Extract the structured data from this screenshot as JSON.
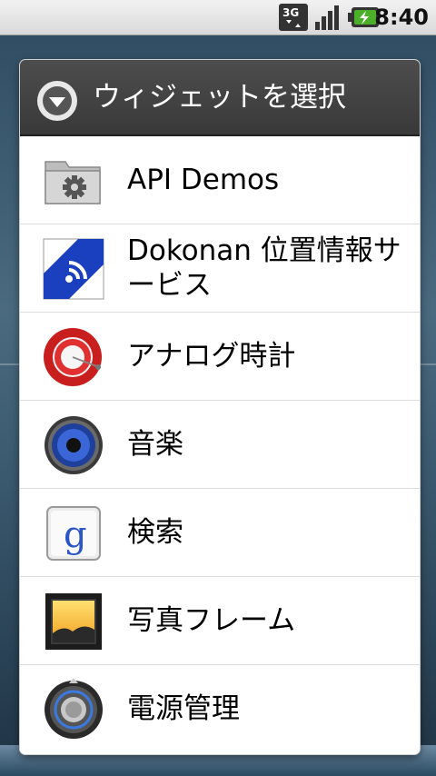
{
  "status_bar": {
    "network_icon": "3g-icon",
    "signal_icon": "signal-icon",
    "battery_icon": "battery-charging-icon",
    "time": "8:40"
  },
  "dialog": {
    "title": "ウィジェットを選択",
    "title_icon": "chevron-down-circle-icon",
    "items": [
      {
        "label": "API Demos",
        "icon": "gear-folder-icon"
      },
      {
        "label": "Dokonan 位置情報サービス",
        "icon": "dokonan-icon"
      },
      {
        "label": "アナログ時計",
        "icon": "analog-clock-icon"
      },
      {
        "label": "音楽",
        "icon": "speaker-icon"
      },
      {
        "label": "検索",
        "icon": "google-search-icon"
      },
      {
        "label": "写真フレーム",
        "icon": "picture-frame-icon"
      },
      {
        "label": "電源管理",
        "icon": "power-control-icon"
      }
    ]
  },
  "colors": {
    "header_bg": "#3e3e3e",
    "item_bg": "#ffffff",
    "divider": "#dcdcdc"
  }
}
